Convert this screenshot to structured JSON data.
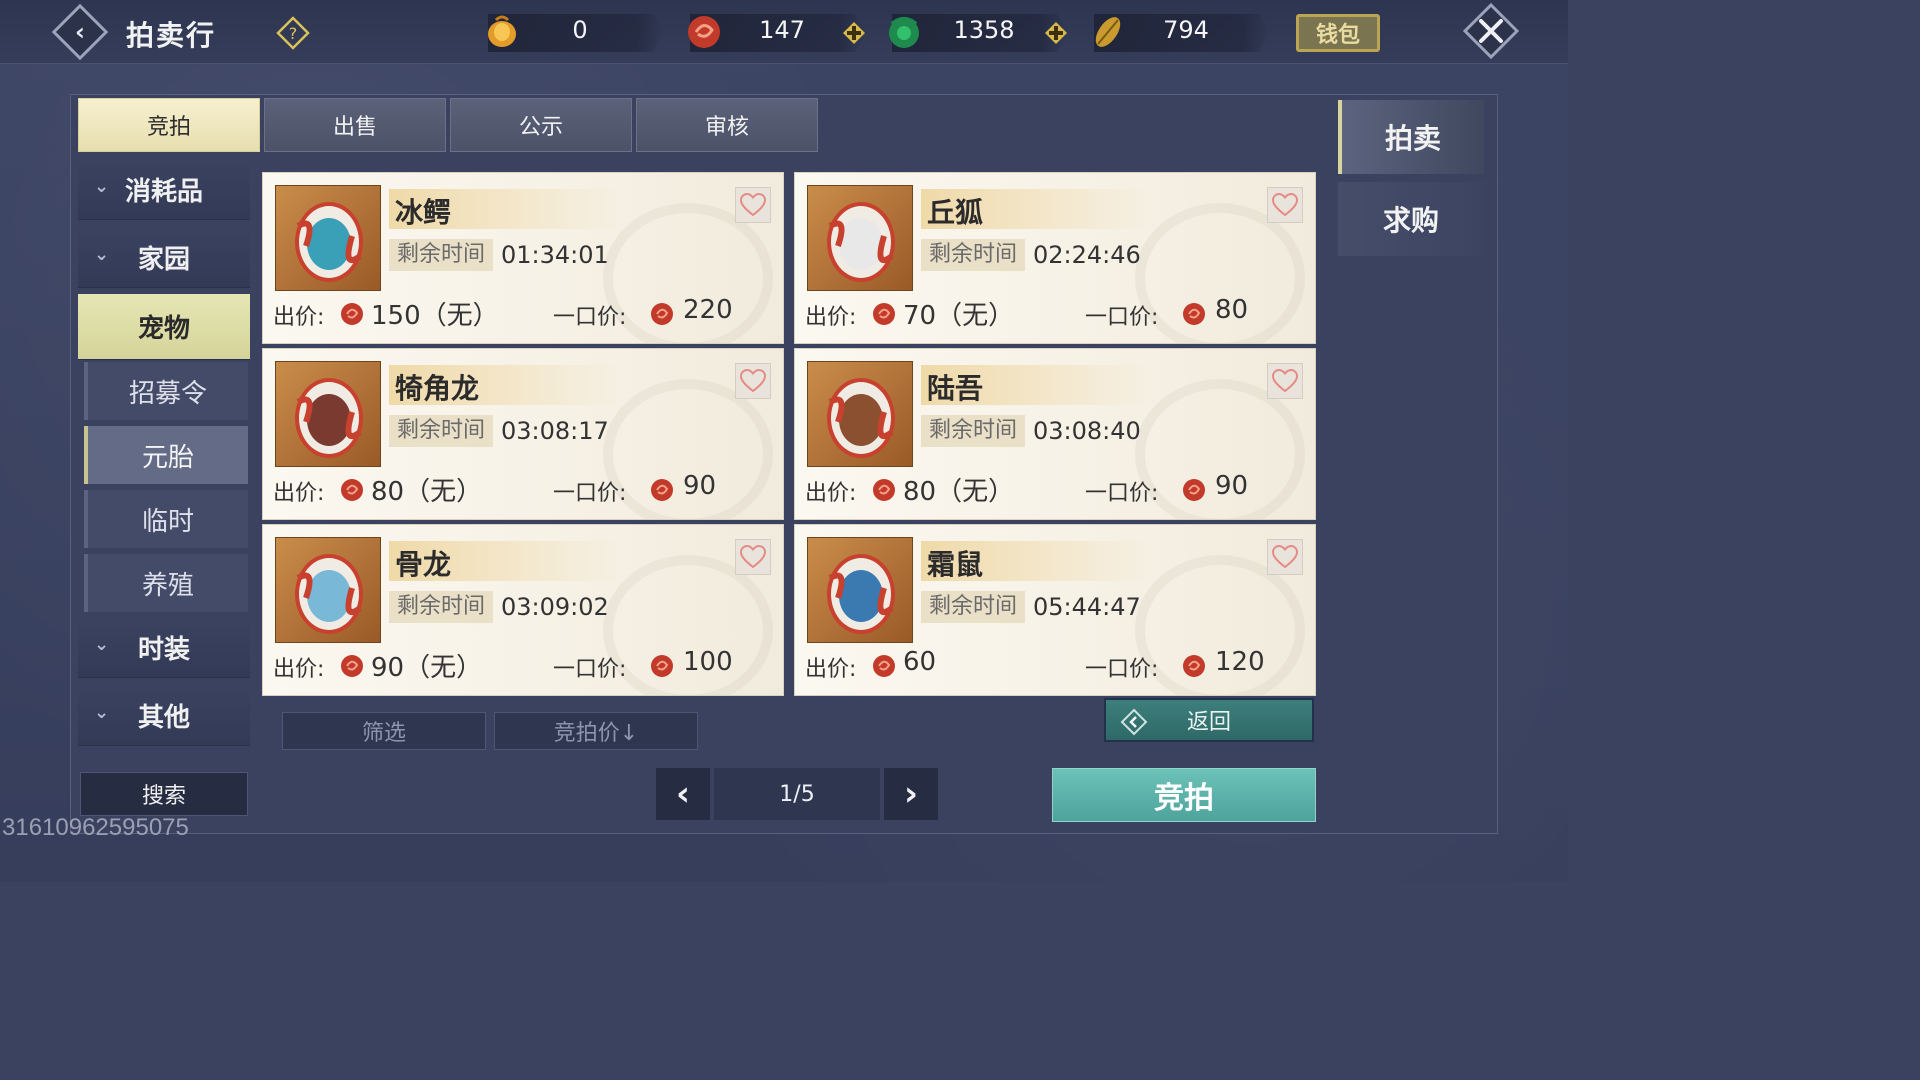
{
  "header": {
    "title": "拍卖行",
    "currencies": [
      {
        "icon": "gold-ingot-icon",
        "value": "0"
      },
      {
        "icon": "red-swirl-coin-icon",
        "value": "147"
      },
      {
        "icon": "jade-coin-icon",
        "value": "1358"
      },
      {
        "icon": "gold-leaf-icon",
        "value": "794"
      }
    ],
    "wallet_label": "钱包"
  },
  "tabs": [
    {
      "label": "竞拍",
      "active": true
    },
    {
      "label": "出售",
      "active": false
    },
    {
      "label": "公示",
      "active": false
    },
    {
      "label": "审核",
      "active": false
    }
  ],
  "sidebar": {
    "categories": [
      {
        "label": "消耗品"
      },
      {
        "label": "家园"
      },
      {
        "label": "宠物"
      }
    ],
    "subitems": [
      {
        "label": "招募令"
      },
      {
        "label": "元胎"
      },
      {
        "label": "临时"
      },
      {
        "label": "养殖"
      }
    ],
    "bottom_categories": [
      {
        "label": "时装"
      },
      {
        "label": "其他"
      }
    ],
    "search_label": "搜索"
  },
  "listings": [
    {
      "name": "冰鳄",
      "time_label": "剩余时间",
      "time": "01:34:01",
      "price_label": "出价:",
      "price": "150（无）",
      "buyout_label": "一口价:",
      "buyout": "220",
      "color": "#3aa0b8"
    },
    {
      "name": "丘狐",
      "time_label": "剩余时间",
      "time": "02:24:46",
      "price_label": "出价:",
      "price": "70（无）",
      "buyout_label": "一口价:",
      "buyout": "80",
      "color": "#e8e8e8"
    },
    {
      "name": "犄角龙",
      "time_label": "剩余时间",
      "time": "03:08:17",
      "price_label": "出价:",
      "price": "80（无）",
      "buyout_label": "一口价:",
      "buyout": "90",
      "color": "#7a3a30"
    },
    {
      "name": "陆吾",
      "time_label": "剩余时间",
      "time": "03:08:40",
      "price_label": "出价:",
      "price": "80（无）",
      "buyout_label": "一口价:",
      "buyout": "90",
      "color": "#8a5030"
    },
    {
      "name": "骨龙",
      "time_label": "剩余时间",
      "time": "03:09:02",
      "price_label": "出价:",
      "price": "90（无）",
      "buyout_label": "一口价:",
      "buyout": "100",
      "color": "#7ab8d8"
    },
    {
      "name": "霜鼠",
      "time_label": "剩余时间",
      "time": "05:44:47",
      "price_label": "出价:",
      "price": "60",
      "buyout_label": "一口价:",
      "buyout": "120",
      "color": "#3a7ab0"
    }
  ],
  "controls": {
    "filter_label": "筛选",
    "sort_label": "竞拍价↓",
    "return_label": "返回",
    "page_text": "1/5",
    "bid_label": "竞拍"
  },
  "right_tabs": [
    {
      "label": "拍卖",
      "active": true
    },
    {
      "label": "求购",
      "active": false
    }
  ],
  "uid_watermark": "31610962595075"
}
